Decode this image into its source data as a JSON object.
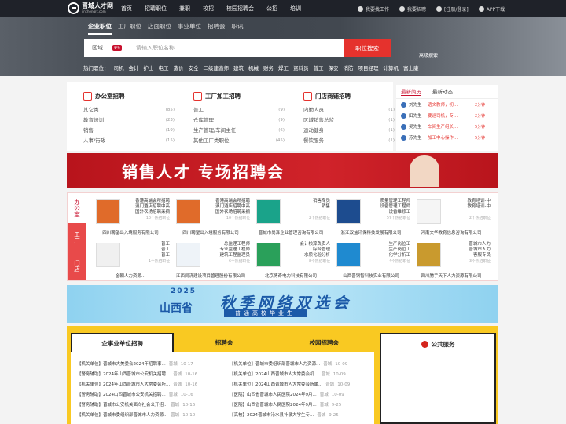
{
  "topbar": {
    "logo": "晋城人才网",
    "logo_sub": "jinchengrc.com",
    "nav": [
      "首页",
      "招聘职位",
      "兼职",
      "校招",
      "校园招聘会",
      "公招",
      "培训"
    ],
    "right": [
      "我要找工作",
      "我要招聘",
      "[注册/登录]",
      "APP下载"
    ]
  },
  "hero": {
    "tabs": [
      "企业职位",
      "工厂职位",
      "店面职位",
      "事业单位",
      "招聘会",
      "职讯"
    ],
    "area": "区域",
    "area_badge": "更多",
    "search_placeholder": "请输入职位名称",
    "search_button": "职位搜索",
    "advanced": "高级搜索",
    "hot_label": "热门职位：",
    "hot": [
      "司机",
      "会计",
      "护士",
      "电工",
      "造价",
      "安全",
      "二级建造师",
      "建筑",
      "机械",
      "财务",
      "焊工",
      "资料员",
      "普工",
      "保安",
      "消防",
      "项目经理",
      "计算机",
      "富士康"
    ]
  },
  "categories": [
    {
      "title": "办公室招聘",
      "rows": [
        [
          "其它类",
          "(85)"
        ],
        [
          "教育培训",
          "(23)"
        ],
        [
          "销售",
          "(19)"
        ],
        [
          "人事/行政",
          "(15)"
        ]
      ]
    },
    {
      "title": "工厂加工招聘",
      "rows": [
        [
          "普工",
          "(9)"
        ],
        [
          "仓库管理",
          "(9)"
        ],
        [
          "生产管理/车间主任",
          "(6)"
        ],
        [
          "其他工厂类职位",
          "(45)"
        ]
      ]
    },
    {
      "title": "门店商铺招聘",
      "rows": [
        [
          "内勤人员",
          "(1)"
        ],
        [
          "区域销售总监",
          "(1)"
        ],
        [
          "运动健身",
          "(1)"
        ],
        [
          "餐饮服务",
          "(1)"
        ]
      ]
    }
  ],
  "latest": {
    "tabs": [
      "最新简历",
      "最新动态"
    ],
    "rows": [
      [
        "刘先生",
        "语文教师，初...",
        "2分钟"
      ],
      [
        "田先生",
        "要运司机，专...",
        "2分钟"
      ],
      [
        "吴先生",
        "车间生产组长...",
        "5分钟"
      ],
      [
        "苏先生",
        "加工中心操作...",
        "5分钟"
      ]
    ]
  },
  "banner1": {
    "text": "销售人才 专场招聘会"
  },
  "side_tabs": [
    "办公室",
    "工厂",
    "门店"
  ],
  "companies": [
    {
      "jobs": [
        "香港高端会所招聘",
        "澳门酒店招聘中高",
        "国外农场招聘采摘"
      ],
      "count": "10个热招职位",
      "name": "四川聘望出入境服务有限公司"
    },
    {
      "jobs": [
        "香港高端会所招聘",
        "澳门酒店招聘中高",
        "国外农场招聘采摘"
      ],
      "count": "10个热招职位",
      "name": "四川聘望出入境服务有限公司"
    },
    {
      "jobs": [
        "销售专员",
        "销售"
      ],
      "count": "2个热招职位",
      "name": "晋城市尚泽企业管理咨询有限公司"
    },
    {
      "jobs": [
        "质量管理工程师",
        "设备管理工程师",
        "设备维修工"
      ],
      "count": "57个热招职位",
      "name": "浙江双益环保科技发展有限公司"
    },
    {
      "jobs": [
        "教育培训-中",
        "教育培训-中"
      ],
      "count": "2个热招职位",
      "name": "河南文华教育信息咨询有限公司"
    },
    {
      "jobs": [
        "普工",
        "普工",
        "普工"
      ],
      "count": "1个热招职位",
      "name": "金朝人力资源..."
    },
    {
      "jobs": [
        "总监理工程师",
        "专业监理工程师",
        "建筑工程监理员"
      ],
      "count": "6个热招职位",
      "name": "江西同济建设项目管理股份有限公司"
    },
    {
      "jobs": [
        "会计核算负责人",
        "综合管理",
        "水质化验分析"
      ],
      "count": "8个热招职位",
      "name": "北京博奇电力科技有限公司"
    },
    {
      "jobs": [
        "生产岗位工",
        "生产岗位工",
        "化学分析工"
      ],
      "count": "4个热招职位",
      "name": "山西晋钢智科技实业有限公司"
    },
    {
      "jobs": [
        "晋城市人力",
        "晋城市人力",
        "客服专员"
      ],
      "count": "3个热招职位",
      "name": "四川腾手天下人力资源有限公司"
    }
  ],
  "banner2": {
    "year": "2025",
    "prov": "山西省",
    "title": "秋季网络双选会",
    "sub": "普通高校毕业生"
  },
  "bottom_tabs": [
    "企事业单位招聘",
    "招聘会",
    "校园招聘会"
  ],
  "list": [
    [
      "【机关单位】晋城市大美委会2024年招聘事...",
      "晋城",
      "10-17"
    ],
    [
      "【机关单位】晋城市委组织部晋城市人力资源...",
      "晋城",
      "10-09"
    ],
    [
      "【警务辅助】2024年山西晋城市公安机关招聘...",
      "晋城",
      "10-16"
    ],
    [
      "【机关单位】2024山西晋城市人大常委会机...",
      "晋城",
      "10-09"
    ],
    [
      "【机关单位】2024年山西晋城市人大常委会所...",
      "晋城",
      "10-16"
    ],
    [
      "【机关单位】2024山西晋城市人大常委会所属...",
      "晋城",
      "10-09"
    ],
    [
      "【警务辅助】2024山西晋城市公安机关招聘...",
      "晋城",
      "10-16"
    ],
    [
      "【医院】山西省晋城市人民医院2024年9月...",
      "晋城",
      "10-09"
    ],
    [
      "【警务辅助】晋城市公安机关面向社会公开招...",
      "晋城",
      "10-16"
    ],
    [
      "【医院】山西省晋城市人民医院2024年9月...",
      "晋城",
      "9-25"
    ],
    [
      "【机关单位】晋城市委组织部晋城市人力资源...",
      "晋城",
      "10-10"
    ],
    [
      "【高校】2024晋城市沁水县补录大学生专...",
      "晋城",
      "9-25"
    ]
  ],
  "public": {
    "title": "公共服务"
  },
  "colors": {
    "accent": "#e5322d",
    "dark": "#1f2229",
    "yellow": "#f9c922"
  }
}
